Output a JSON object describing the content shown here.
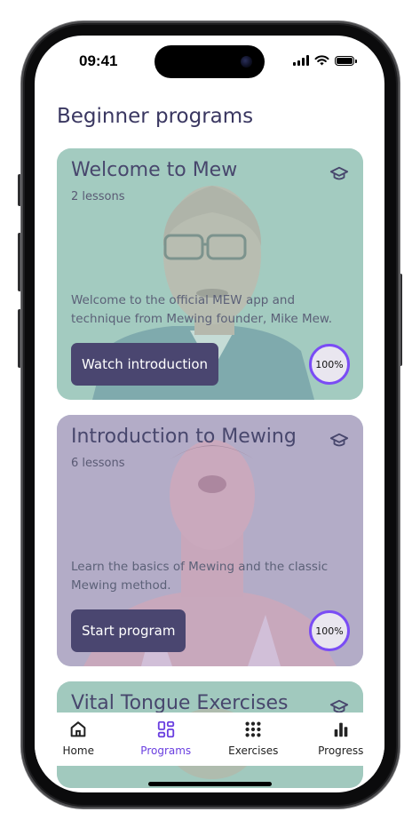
{
  "status_bar": {
    "time": "09:41"
  },
  "page": {
    "title": "Beginner programs"
  },
  "programs": [
    {
      "title": "Welcome to Mew",
      "lessons": "2 lessons",
      "description": "Welcome to the official MEW app and technique from Mewing founder, Mike Mew.",
      "button_label": "Watch introduction",
      "progress": "100%",
      "tint": "#a9cfc5",
      "icon": "graduation-cap-icon"
    },
    {
      "title": "Introduction to Mewing",
      "lessons": "6 lessons",
      "description": "Learn the basics of Mewing and the classic Mewing method.",
      "button_label": "Start program",
      "progress": "100%",
      "tint": "#c2a8cc",
      "icon": "graduation-cap-icon"
    },
    {
      "title": "Vital Tongue Exercises",
      "tint": "#a9cfc5",
      "icon": "graduation-cap-icon"
    }
  ],
  "tabs": [
    {
      "label": "Home",
      "icon": "home-icon",
      "active": false
    },
    {
      "label": "Programs",
      "icon": "programs-grid-icon",
      "active": true
    },
    {
      "label": "Exercises",
      "icon": "dots-grid-icon",
      "active": false
    },
    {
      "label": "Progress",
      "icon": "bar-chart-icon",
      "active": false
    }
  ],
  "colors": {
    "accent": "#6a3fe0",
    "title_text": "#3a3761",
    "button_bg": "#4a4670",
    "progress_ring": "#7a4cf5"
  }
}
